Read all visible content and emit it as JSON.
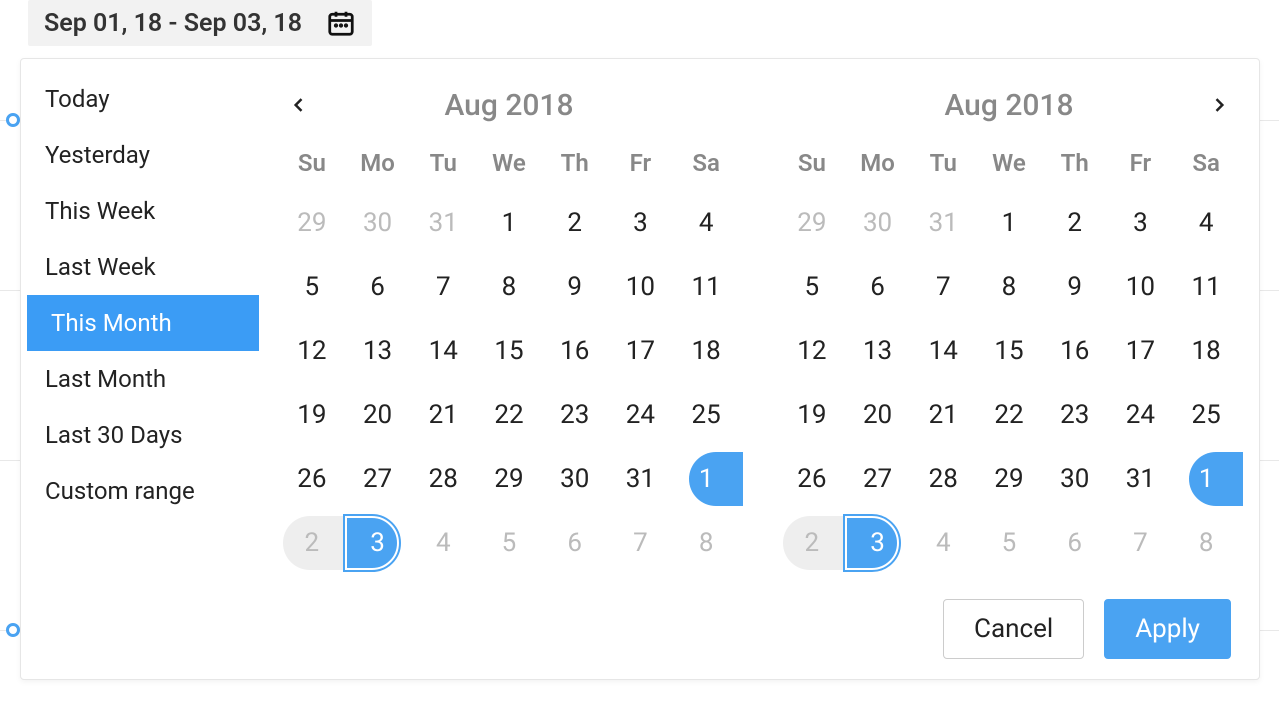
{
  "trigger": {
    "text": "Sep 01, 18 - Sep 03, 18"
  },
  "presets": [
    {
      "label": "Today",
      "selected": false
    },
    {
      "label": "Yesterday",
      "selected": false
    },
    {
      "label": "This Week",
      "selected": false
    },
    {
      "label": "Last Week",
      "selected": false
    },
    {
      "label": "This Month",
      "selected": true
    },
    {
      "label": "Last Month",
      "selected": false
    },
    {
      "label": "Last 30 Days",
      "selected": false
    },
    {
      "label": "Custom range",
      "selected": false
    }
  ],
  "dow": [
    "Su",
    "Mo",
    "Tu",
    "We",
    "Th",
    "Fr",
    "Sa"
  ],
  "calendars": [
    {
      "title": "Aug 2018",
      "show_prev": true,
      "show_next": false,
      "days": [
        {
          "n": "29",
          "muted": true
        },
        {
          "n": "30",
          "muted": true
        },
        {
          "n": "31",
          "muted": true
        },
        {
          "n": "1"
        },
        {
          "n": "2"
        },
        {
          "n": "3"
        },
        {
          "n": "4"
        },
        {
          "n": "5"
        },
        {
          "n": "6"
        },
        {
          "n": "7"
        },
        {
          "n": "8"
        },
        {
          "n": "9"
        },
        {
          "n": "10"
        },
        {
          "n": "11"
        },
        {
          "n": "12"
        },
        {
          "n": "13"
        },
        {
          "n": "14"
        },
        {
          "n": "15"
        },
        {
          "n": "16"
        },
        {
          "n": "17"
        },
        {
          "n": "18"
        },
        {
          "n": "19"
        },
        {
          "n": "20"
        },
        {
          "n": "21"
        },
        {
          "n": "22"
        },
        {
          "n": "23"
        },
        {
          "n": "24"
        },
        {
          "n": "25"
        },
        {
          "n": "26"
        },
        {
          "n": "27"
        },
        {
          "n": "28"
        },
        {
          "n": "29"
        },
        {
          "n": "30"
        },
        {
          "n": "31"
        },
        {
          "n": "1",
          "muted": true,
          "ep": "start"
        },
        {
          "n": "2",
          "muted": true,
          "range": "start"
        },
        {
          "n": "3",
          "muted": true,
          "ep": "end",
          "range": "end"
        },
        {
          "n": "4",
          "muted": true
        },
        {
          "n": "5",
          "muted": true
        },
        {
          "n": "6",
          "muted": true
        },
        {
          "n": "7",
          "muted": true
        },
        {
          "n": "8",
          "muted": true
        }
      ]
    },
    {
      "title": "Aug 2018",
      "show_prev": false,
      "show_next": true,
      "days": [
        {
          "n": "29",
          "muted": true
        },
        {
          "n": "30",
          "muted": true
        },
        {
          "n": "31",
          "muted": true
        },
        {
          "n": "1"
        },
        {
          "n": "2"
        },
        {
          "n": "3"
        },
        {
          "n": "4"
        },
        {
          "n": "5"
        },
        {
          "n": "6"
        },
        {
          "n": "7"
        },
        {
          "n": "8"
        },
        {
          "n": "9"
        },
        {
          "n": "10"
        },
        {
          "n": "11"
        },
        {
          "n": "12"
        },
        {
          "n": "13"
        },
        {
          "n": "14"
        },
        {
          "n": "15"
        },
        {
          "n": "16"
        },
        {
          "n": "17"
        },
        {
          "n": "18"
        },
        {
          "n": "19"
        },
        {
          "n": "20"
        },
        {
          "n": "21"
        },
        {
          "n": "22"
        },
        {
          "n": "23"
        },
        {
          "n": "24"
        },
        {
          "n": "25"
        },
        {
          "n": "26"
        },
        {
          "n": "27"
        },
        {
          "n": "28"
        },
        {
          "n": "29"
        },
        {
          "n": "30"
        },
        {
          "n": "31"
        },
        {
          "n": "1",
          "muted": true,
          "ep": "start"
        },
        {
          "n": "2",
          "muted": true,
          "range": "start"
        },
        {
          "n": "3",
          "muted": true,
          "ep": "end",
          "range": "end"
        },
        {
          "n": "4",
          "muted": true
        },
        {
          "n": "5",
          "muted": true
        },
        {
          "n": "6",
          "muted": true
        },
        {
          "n": "7",
          "muted": true
        },
        {
          "n": "8",
          "muted": true
        }
      ]
    }
  ],
  "buttons": {
    "cancel": "Cancel",
    "apply": "Apply"
  },
  "icons": {
    "calendar": "calendar-icon",
    "prev": "chevron-left-icon",
    "next": "chevron-right-icon"
  }
}
